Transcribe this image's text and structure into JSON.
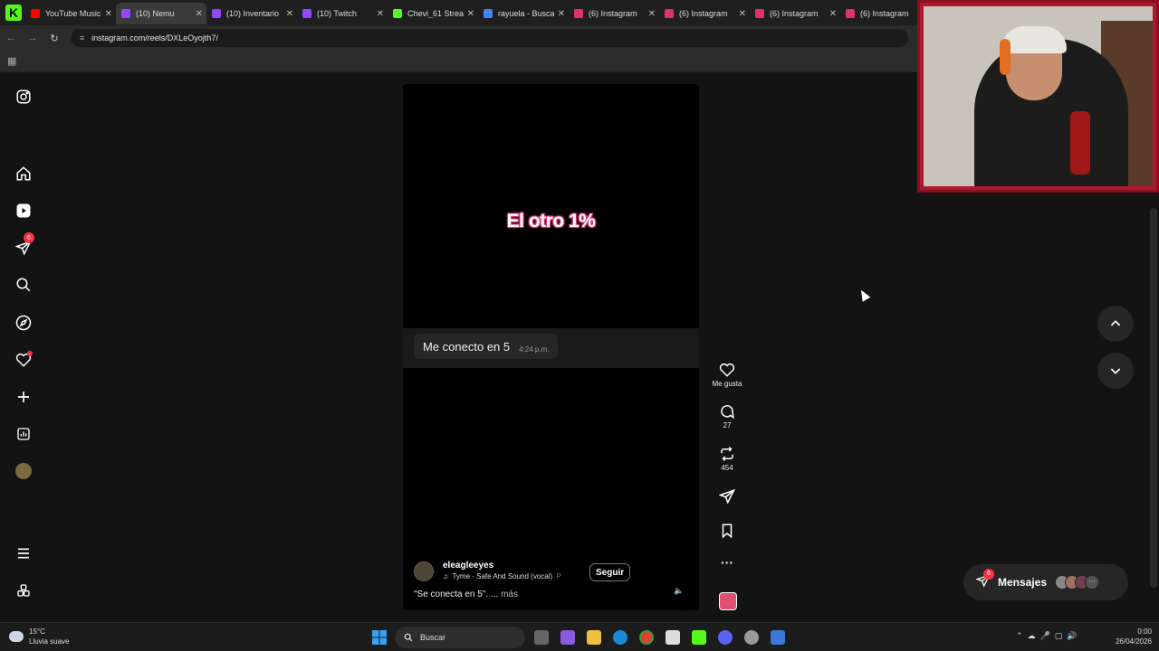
{
  "browser": {
    "tabs": [
      {
        "title": "YouTube Music",
        "fav": "#ff0000"
      },
      {
        "title": "(10) Nemu",
        "fav": "#9146ff",
        "active": true
      },
      {
        "title": "(10) Inventario",
        "fav": "#9146ff"
      },
      {
        "title": "(10) Twitch",
        "fav": "#9146ff"
      },
      {
        "title": "Chevi_61 Strea",
        "fav": "#53fc18"
      },
      {
        "title": "rayuela - Busca",
        "fav": "#4285f4"
      },
      {
        "title": "(6) Instagram",
        "fav": "#e1306c"
      },
      {
        "title": "(6) Instagram",
        "fav": "#e1306c"
      },
      {
        "title": "(6) Instagram",
        "fav": "#e1306c"
      },
      {
        "title": "(6) Instagram",
        "fav": "#e1306c"
      }
    ],
    "url": "instagram.com/reels/DXLeOyojth7/",
    "kick_logo": "K"
  },
  "sidebar": {
    "messages_badge": "6"
  },
  "reel": {
    "overlay_title": "El otro 1%",
    "chat_message": "Me conecto en 5",
    "chat_time": "4:24 p.m.",
    "username": "eleagleeyes",
    "song": "Tyme · Safe And Sound (vocal)",
    "song_cut": "P",
    "follow_label": "Seguir",
    "caption": "\"Se conecta en 5\". ...",
    "caption_more": "más"
  },
  "actions": {
    "like_label": "Me gusta",
    "comments": "27",
    "reposts": "454"
  },
  "messages_bar": {
    "label": "Mensajes",
    "badge": "6"
  },
  "taskbar": {
    "temp": "15°C",
    "weather": "Lluvia suave",
    "search": "Buscar",
    "time": "0:00",
    "date": "26/04/2026"
  },
  "colors": {
    "accent_red": "#ff3040",
    "instagram_pink": "#e1306c",
    "kick_green": "#53fc18"
  }
}
